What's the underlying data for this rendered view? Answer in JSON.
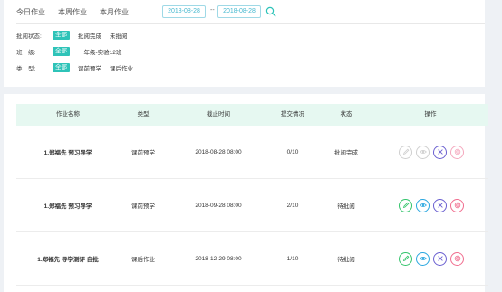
{
  "tabs": [
    "今日作业",
    "本周作业",
    "本月作业"
  ],
  "date_start": "2018-08-28",
  "date_end": "2018-08-28",
  "date_separator": "--",
  "filters": [
    {
      "label": "批阅状态:",
      "options": [
        "全部",
        "批阅完成",
        "未批阅"
      ]
    },
    {
      "label": "班　级:",
      "options": [
        "全部",
        "一年级-实验12班"
      ]
    },
    {
      "label": "类　型:",
      "options": [
        "全部",
        "课前预学",
        "课后作业"
      ]
    }
  ],
  "table": {
    "headers": [
      "作业名称",
      "类型",
      "截止时间",
      "提交情况",
      "状态",
      "操作"
    ],
    "rows": [
      {
        "name": "1.郑福先 预习导学",
        "type": "课前预学",
        "deadline": "2018-08-28 08:00",
        "submit": "0/10",
        "status": "批阅完成",
        "disabled": true
      },
      {
        "name": "1.郑福先 预习导学",
        "type": "课前预学",
        "deadline": "2018-09-28 08:00",
        "submit": "2/10",
        "status": "待批阅",
        "disabled": false
      },
      {
        "name": "1.郑福先 导学测评 自批",
        "type": "课后作业",
        "deadline": "2018-12-29 08:00",
        "submit": "1/10",
        "status": "待批阅",
        "disabled": false
      }
    ]
  },
  "colors": {
    "accent": "#2ec3b8",
    "header_bg": "#e6f8f1",
    "edit": "#33c46b",
    "view": "#2aa7e0",
    "close": "#6a5fd0",
    "delete": "#f06c8e"
  },
  "icons": [
    "search-icon",
    "edit-icon",
    "view-icon",
    "close-icon",
    "delete-icon"
  ]
}
